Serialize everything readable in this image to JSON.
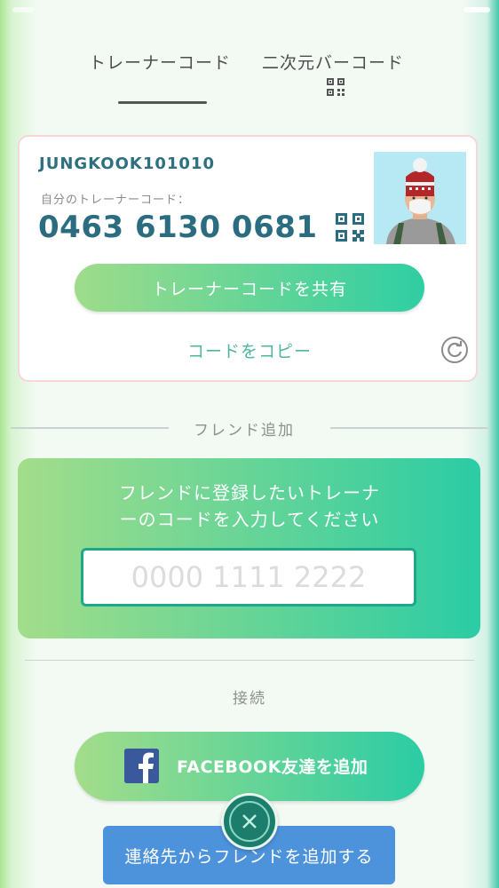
{
  "tabs": {
    "trainer_code": "トレーナーコード",
    "qr_code": "二次元バーコード",
    "active": "trainer_code"
  },
  "profile": {
    "username": "JUNGKOOK101010",
    "code_caption": "自分のトレーナーコード：",
    "trainer_code": "0463 6130 0681",
    "avatar_icon": "trainer-avatar"
  },
  "actions": {
    "share_label": "トレーナーコードを共有",
    "copy_label": "コードをコピー"
  },
  "friend_section": {
    "title": "フレンド追加",
    "instructions_line1": "フレンドに登録したいトレーナ",
    "instructions_line2": "ーのコードを入力してください",
    "input_placeholder": "0000 1111 2222",
    "input_value": ""
  },
  "connect_section": {
    "title": "接続",
    "facebook_label": "FACEBOOK友達を追加",
    "contacts_label": "連絡先からフレンドを追加する"
  },
  "colors": {
    "accent_green": "#2bcca4",
    "accent_light": "#a3dd8a",
    "code_text": "#2b6c80",
    "contacts_blue": "#4d93dc",
    "close_dark": "#1d7d6c"
  },
  "icons": {
    "tab_qr": "qr-code-icon",
    "card_qr": "qr-code-icon",
    "refresh": "refresh-icon",
    "facebook": "facebook-icon",
    "close": "close-icon"
  }
}
